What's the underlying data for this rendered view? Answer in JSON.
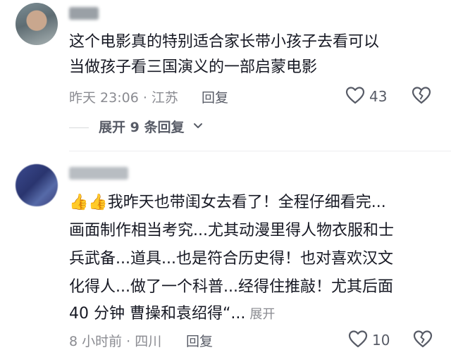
{
  "comments": [
    {
      "line1": "这个电影真的特别适合家长带小孩子去看可以",
      "line2": "当做孩子看三国演义的一部启蒙电影",
      "time_location": "昨天 23:06 · 江苏",
      "reply_label": "回复",
      "like_count": "43",
      "expand_replies": "展开 9 条回复"
    },
    {
      "line1_emojis": "👍👍",
      "line1": "我昨天也带闺女去看了！全程仔细看完...",
      "line2": "画面制作相当考究...尤其动漫里得人物衣服和士",
      "line3": "兵武备...道具...也是符合历史得！也对喜欢汉文",
      "line4": "化得人...做了一个科普...经得住推敲！尤其后面",
      "line5": "40 分钟 曹操和袁绍得“...",
      "expand_label": "展开",
      "time_location": "8 小时前 · 四川",
      "reply_label": "回复",
      "like_count": "10"
    }
  ],
  "icons": {
    "like": "heart-outline-icon",
    "dislike": "broken-heart-icon",
    "expand": "chevron-down-icon"
  },
  "colors": {
    "text": "#161823",
    "meta": "#8a8b91",
    "secondary": "#575b66"
  }
}
